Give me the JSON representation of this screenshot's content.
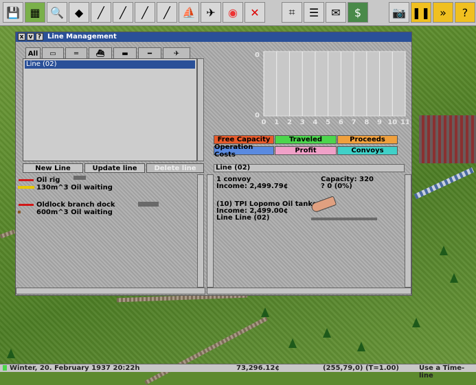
{
  "window": {
    "title": "Line Management",
    "close_glyph": "x",
    "pin_glyph": "v",
    "help_glyph": "?"
  },
  "tabs": [
    {
      "label": "All",
      "icon": "all-icon"
    },
    {
      "label": "",
      "icon": "truck-icon"
    },
    {
      "label": "",
      "icon": "train-icon"
    },
    {
      "label": "",
      "icon": "ship-icon"
    },
    {
      "label": "",
      "icon": "tram-icon"
    },
    {
      "label": "",
      "icon": "monorail-icon"
    },
    {
      "label": "",
      "icon": "aircraft-icon"
    }
  ],
  "line_list": {
    "items": [
      "Line (02)"
    ]
  },
  "buttons": {
    "new_line": "New Line",
    "update_line": "Update line",
    "delete_line": "Delete line"
  },
  "stops": [
    {
      "name": "Oil rig",
      "waiting": "130m^3 Oil waiting"
    },
    {
      "name": "Oldlock branch dock",
      "waiting": "600m^3 Oil waiting"
    }
  ],
  "chart_data": {
    "type": "line",
    "x": [
      0,
      1,
      2,
      3,
      4,
      5,
      6,
      7,
      8,
      9,
      10,
      11
    ],
    "y_tick_labels": [
      "0",
      "0"
    ],
    "x_tick_labels": [
      "0",
      "1",
      "2",
      "3",
      "4",
      "5",
      "6",
      "7",
      "8",
      "9",
      "10",
      "11"
    ],
    "series": [],
    "grid": true
  },
  "legend_buttons": [
    {
      "label": "Free Capacity",
      "color": "#e85a2a"
    },
    {
      "label": "Traveled",
      "color": "#4cd64c"
    },
    {
      "label": "Proceeds",
      "color": "#f0a03c"
    },
    {
      "label": "Operation Costs",
      "color": "#5a8ae0"
    },
    {
      "label": "Profit",
      "color": "#f0a0c8"
    },
    {
      "label": "Convoys",
      "color": "#40d0c8"
    }
  ],
  "line_panel": {
    "name": "Line (02)",
    "convoys": "1 convoy",
    "income": "Income: 2,499.79¢",
    "capacity": "Capacity: 320",
    "load": "? 0 (0%)",
    "vehicle_name": "(10) TPI Lopomo Oil tanker",
    "vehicle_income": "Income: 2,499.00¢",
    "vehicle_line": "Line Line (02)",
    "vehicle_load_fraction": 0
  },
  "status_bar": {
    "date": "Winter, 20. February 1937 20:22h",
    "money": "73,296.12¢",
    "coords": "(255,79,0) (T=1.00)",
    "tool": "Use a Time-line"
  },
  "colors": {
    "title_bar": "#2a5098",
    "stop_line": "#d01818"
  }
}
